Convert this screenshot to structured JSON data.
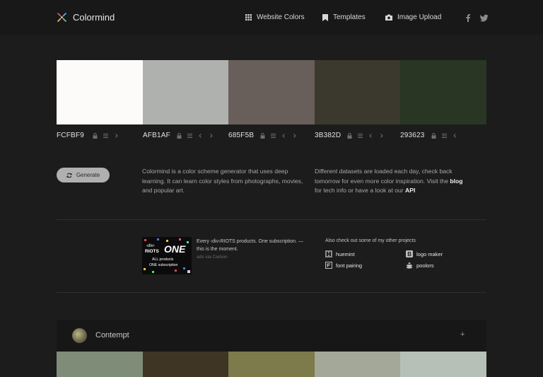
{
  "header": {
    "brand": "Colormind",
    "nav": [
      {
        "label": "Website Colors",
        "icon": "grid-icon"
      },
      {
        "label": "Templates",
        "icon": "bookmark-icon"
      },
      {
        "label": "Image Upload",
        "icon": "camera-icon"
      }
    ],
    "social": [
      "facebook-icon",
      "twitter-icon"
    ]
  },
  "palette": {
    "colors": [
      {
        "code": "FCFBF9",
        "hex": "#FCFBF9"
      },
      {
        "code": "AFB1AF",
        "hex": "#AFB1AF"
      },
      {
        "code": "685F5B",
        "hex": "#685F5B"
      },
      {
        "code": "3B382D",
        "hex": "#3B382D"
      },
      {
        "code": "293623",
        "hex": "#293623"
      }
    ]
  },
  "generate_label": "Generate",
  "about": {
    "text": "Colormind is a color scheme generator that uses deep learning. It can learn color styles from photographs, movies, and popular art."
  },
  "datasets": {
    "text_before": "Different datasets are loaded each day, check back tomorrow for even more color inspiration. Visit the ",
    "blog_link": "blog",
    "text_middle": " for tech info or have a look at our ",
    "api_link": "API"
  },
  "ad": {
    "text": "Every ‹div›RIOTS products. One subscription. — this is the moment.",
    "via": "ads via Carbon",
    "image_lines": [
      "‹div›",
      "RIOTS",
      "ONE",
      "ALL products",
      "ONE subscription"
    ]
  },
  "projects": {
    "heading": "Also check out some of my other projects",
    "items": [
      {
        "label": "huemint",
        "icon": "huemint-icon"
      },
      {
        "label": "logo maker",
        "icon": "logo-maker-icon"
      },
      {
        "label": "font pairing",
        "icon": "font-pairing-icon"
      },
      {
        "label": "poolors",
        "icon": "poolors-icon"
      }
    ]
  },
  "featured_palette": {
    "name": "Contempt",
    "plus": "+",
    "colors": [
      "#7F8C78",
      "#3E3524",
      "#7D7A4B",
      "#A4A898",
      "#B6C0B6"
    ]
  }
}
